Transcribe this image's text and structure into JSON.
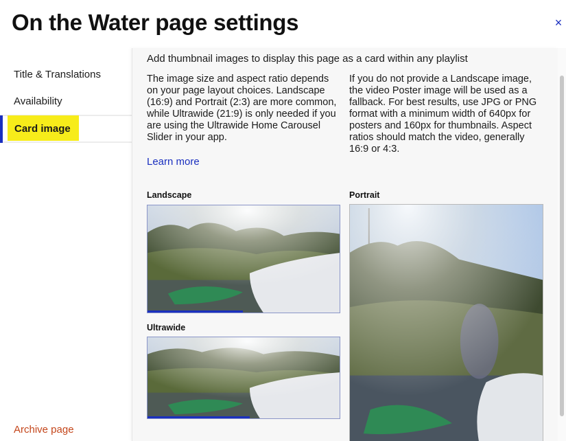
{
  "header": {
    "title": "On the Water page settings",
    "close_label": "×"
  },
  "sidebar": {
    "items": [
      {
        "label": "Title & Translations",
        "active": false
      },
      {
        "label": "Availability",
        "active": false
      },
      {
        "label": "Card image",
        "active": true
      }
    ],
    "archive_label": "Archive page"
  },
  "main": {
    "intro": "Add thumbnail images to display this page as a card within any playlist",
    "para_left": "The image size and aspect ratio depends on your page layout choices. Landscape (16:9) and Portrait (2:3) are more common, while Ultrawide (21:9) is only needed if you are using the Ultrawide Home Carousel Slider in your app.",
    "para_right": "If you do not provide a Landscape image, the video Poster image will be used as a fallback. For best results, use JPG or PNG format with a minimum width of 640px for posters and 160px for thumbnails. Aspect ratios should match the video, generally 16:9 or 4:3.",
    "learn_more": "Learn more",
    "images": {
      "landscape_label": "Landscape",
      "portrait_label": "Portrait",
      "ultrawide_label": "Ultrawide"
    }
  },
  "colors": {
    "accent": "#1a2fbf",
    "highlight": "#f7ec1a",
    "archive": "#c4461b",
    "panel_bg": "#f7f7f7"
  }
}
